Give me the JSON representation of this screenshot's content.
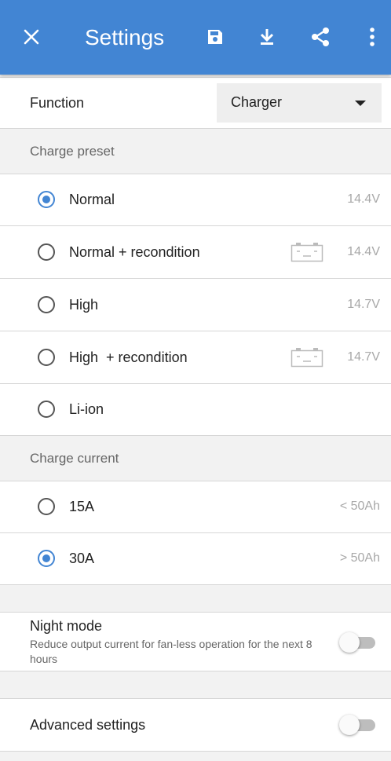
{
  "toolbar": {
    "title": "Settings",
    "close_icon": "close-icon",
    "save_icon": "save-icon",
    "download_icon": "download-icon",
    "share_icon": "share-icon",
    "more_icon": "more-vert-icon"
  },
  "function": {
    "label": "Function",
    "selected": "Charger"
  },
  "charge_preset": {
    "header": "Charge preset",
    "options": [
      {
        "label": "Normal",
        "value": "14.4V",
        "selected": true,
        "battery_icon": false
      },
      {
        "label": "Normal + recondition",
        "value": "14.4V",
        "selected": false,
        "battery_icon": true
      },
      {
        "label": "High",
        "value": "14.7V",
        "selected": false,
        "battery_icon": false
      },
      {
        "label": "High  + recondition",
        "value": "14.7V",
        "selected": false,
        "battery_icon": true
      },
      {
        "label": "Li-ion",
        "value": "",
        "selected": false,
        "battery_icon": false
      }
    ]
  },
  "charge_current": {
    "header": "Charge current",
    "options": [
      {
        "label": "15A",
        "value": "< 50Ah",
        "selected": false
      },
      {
        "label": "30A",
        "value": "> 50Ah",
        "selected": true
      }
    ]
  },
  "night_mode": {
    "title": "Night mode",
    "description": "Reduce output current for fan-less operation for the next 8 hours",
    "enabled": false
  },
  "advanced": {
    "title": "Advanced settings",
    "enabled": false
  },
  "colors": {
    "accent": "#4285d3",
    "toolbar_text": "#ffffff"
  }
}
